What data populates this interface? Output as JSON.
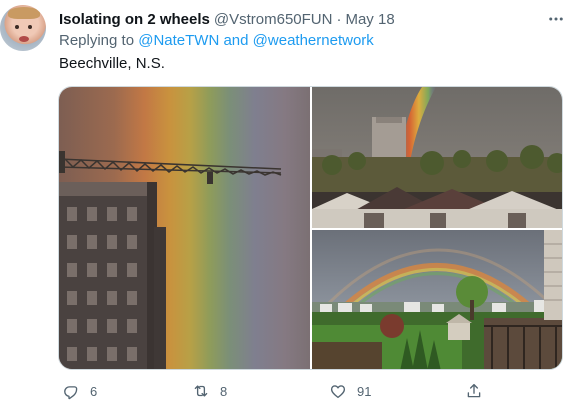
{
  "author": {
    "display_name": "Isolating on 2 wheels",
    "handle": "@Vstrom650FUN",
    "separator": "·",
    "date": "May 18"
  },
  "reply": {
    "prefix": "Replying to",
    "mention_1": "@NateTWN",
    "joiner": "and",
    "mention_2": "@weathernetwork"
  },
  "tweet": {
    "text": "Beechville, N.S."
  },
  "media": {
    "photo_count": 3,
    "photos": [
      "rainbow-crane-closeup",
      "rainbow-over-building",
      "double-rainbow-backyard"
    ]
  },
  "actions": {
    "reply_count": "6",
    "retweet_count": "8",
    "like_count": "91",
    "icons": [
      "reply-icon",
      "retweet-icon",
      "like-icon",
      "share-icon"
    ]
  },
  "colors": {
    "text": "#0f1419",
    "secondary": "#536471",
    "link": "#1d9bf0",
    "border": "#cfd9de"
  }
}
